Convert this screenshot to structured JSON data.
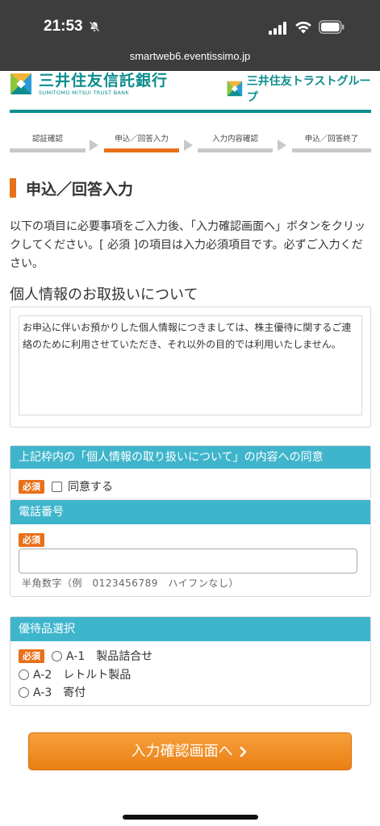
{
  "status_bar": {
    "time": "21:53"
  },
  "browser": {
    "url": "smartweb6.eventissimo.jp"
  },
  "header": {
    "left_logo_name": "三井住友信託銀行",
    "left_logo_sub": "SUMITOMO MITSUI TRUST BANK",
    "right_logo_name": "三井住友トラストグループ"
  },
  "steps": [
    {
      "label": "認証確認",
      "active": false
    },
    {
      "label": "申込／回答入力",
      "active": true
    },
    {
      "label": "入力内容確認",
      "active": false
    },
    {
      "label": "申込／回答終了",
      "active": false
    }
  ],
  "page_title": "申込／回答入力",
  "intro_text": "以下の項目に必要事項をご入力後、「入力確認画面へ」ボタンをクリックしてください。[ 必須 ]の項目は入力必須項目です。必ずご入力ください。",
  "privacy": {
    "title": "個人情報のお取扱いについて",
    "body": "お申込に伴いお預かりした個人情報につきましては、株主優待に関するご連絡のために利用させていただき、それ以外の目的では利用いたしません。"
  },
  "consent": {
    "header": "上記枠内の「個人情報の取り扱いについて」の内容への同意",
    "required_badge": "必須",
    "checkbox_label": "同意する"
  },
  "phone": {
    "header": "電話番号",
    "required_badge": "必須",
    "value": "",
    "hint": "半角数字（例　0123456789　ハイフンなし）"
  },
  "gift": {
    "header": "優待品選択",
    "required_badge": "必須",
    "options": [
      "A-1　製品詰合せ",
      "A-2　レトルト製品",
      "A-3　寄付"
    ]
  },
  "submit_label": "入力確認画面へ",
  "colors": {
    "accent": "#e8701a",
    "brand": "#0d8d8e",
    "section_header": "#3fb5cc"
  }
}
